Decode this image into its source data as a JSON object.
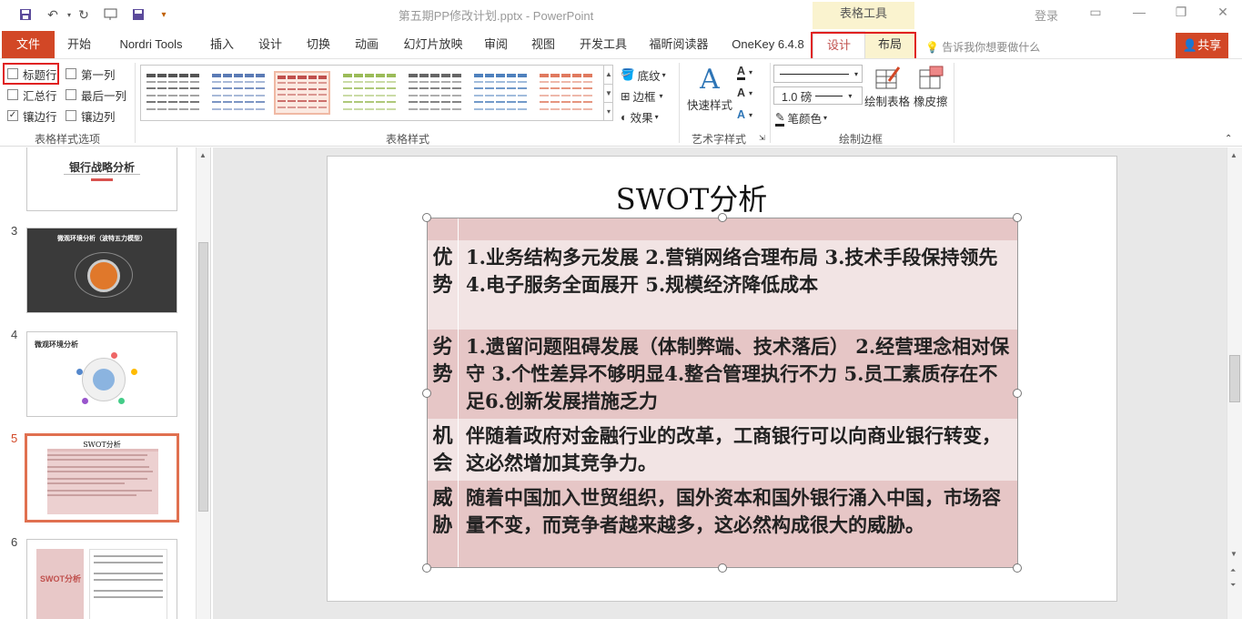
{
  "titlebar": {
    "doc_name": "第五期PP修改计划.pptx",
    "separator": " - ",
    "app_name": "PowerPoint",
    "context_tab_group": "表格工具",
    "login": "登录"
  },
  "tabs": [
    {
      "id": "file",
      "label": "文件"
    },
    {
      "id": "home",
      "label": "开始"
    },
    {
      "id": "nordri",
      "label": "Nordri Tools"
    },
    {
      "id": "insert",
      "label": "插入"
    },
    {
      "id": "design",
      "label": "设计"
    },
    {
      "id": "transitions",
      "label": "切换"
    },
    {
      "id": "animations",
      "label": "动画"
    },
    {
      "id": "slideshow",
      "label": "幻灯片放映"
    },
    {
      "id": "review",
      "label": "审阅"
    },
    {
      "id": "view",
      "label": "视图"
    },
    {
      "id": "developer",
      "label": "开发工具"
    },
    {
      "id": "foxit",
      "label": "福昕阅读器"
    },
    {
      "id": "onekey",
      "label": "OneKey 6.4.8"
    },
    {
      "id": "table-design",
      "label": "设计"
    },
    {
      "id": "table-layout",
      "label": "布局"
    }
  ],
  "tellme": "告诉我你想要做什么",
  "share": "共享",
  "ribbon": {
    "style_options": {
      "header_row": {
        "label": "标题行",
        "checked": false
      },
      "first_column": {
        "label": "第一列",
        "checked": false
      },
      "total_row": {
        "label": "汇总行",
        "checked": false
      },
      "last_column": {
        "label": "最后一列",
        "checked": false
      },
      "banded_rows": {
        "label": "镶边行",
        "checked": true
      },
      "banded_columns": {
        "label": "镶边列",
        "checked": false
      },
      "group_label": "表格样式选项"
    },
    "table_styles": {
      "group_label": "表格样式",
      "thumb_colors": [
        "#555555",
        "#5b7bb5",
        "#c0504d",
        "#9bbb59",
        "#666666",
        "#4f81bd",
        "#e07a5f"
      ],
      "selected_index": 2,
      "shading": "底纹",
      "borders": "边框",
      "effects": "效果"
    },
    "wordart": {
      "quick_styles": "快速样式",
      "group_label": "艺术字样式"
    },
    "draw_borders": {
      "pen_weight": "1.0 磅",
      "pen_color": "笔颜色",
      "draw_table": "绘制表格",
      "eraser": "橡皮擦",
      "group_label": "绘制边框"
    }
  },
  "slides": [
    {
      "number": "",
      "title": "银行战略分析",
      "selected": false
    },
    {
      "number": "3",
      "title": "微观环境分析（波特五力模型）",
      "selected": false
    },
    {
      "number": "4",
      "title": "微观环境分析",
      "selected": false
    },
    {
      "number": "5",
      "title": "SWOT分析",
      "selected": true
    },
    {
      "number": "6",
      "title": "SWOT分析",
      "selected": false
    }
  ],
  "slide": {
    "title": "SWOT分析",
    "rows": [
      {
        "label1": "",
        "label2": "",
        "content": ""
      },
      {
        "label1": "优",
        "label2": "势",
        "content": "1.业务结构多元发展 2.营销网络合理布局 3.技术手段保持领先 4.电子服务全面展开 5.规模经济降低成本"
      },
      {
        "label1": "劣",
        "label2": "势",
        "content": "1.遗留问题阻碍发展（体制弊端、技术落后） 2.经营理念相对保守 3.个性差异不够明显4.整合管理执行不力 5.员工素质存在不足6.创新发展措施乏力"
      },
      {
        "label1": "机",
        "label2": "会",
        "content": "伴随着政府对金融行业的改革，工商银行可以向商业银行转变，这必然增加其竞争力。"
      },
      {
        "label1": "威",
        "label2": "胁",
        "content": "随着中国加入世贸组织，国外资本和国外银行涌入中国，市场容量不变，而竞争者越来越多，这必然构成很大的威胁。"
      }
    ]
  }
}
